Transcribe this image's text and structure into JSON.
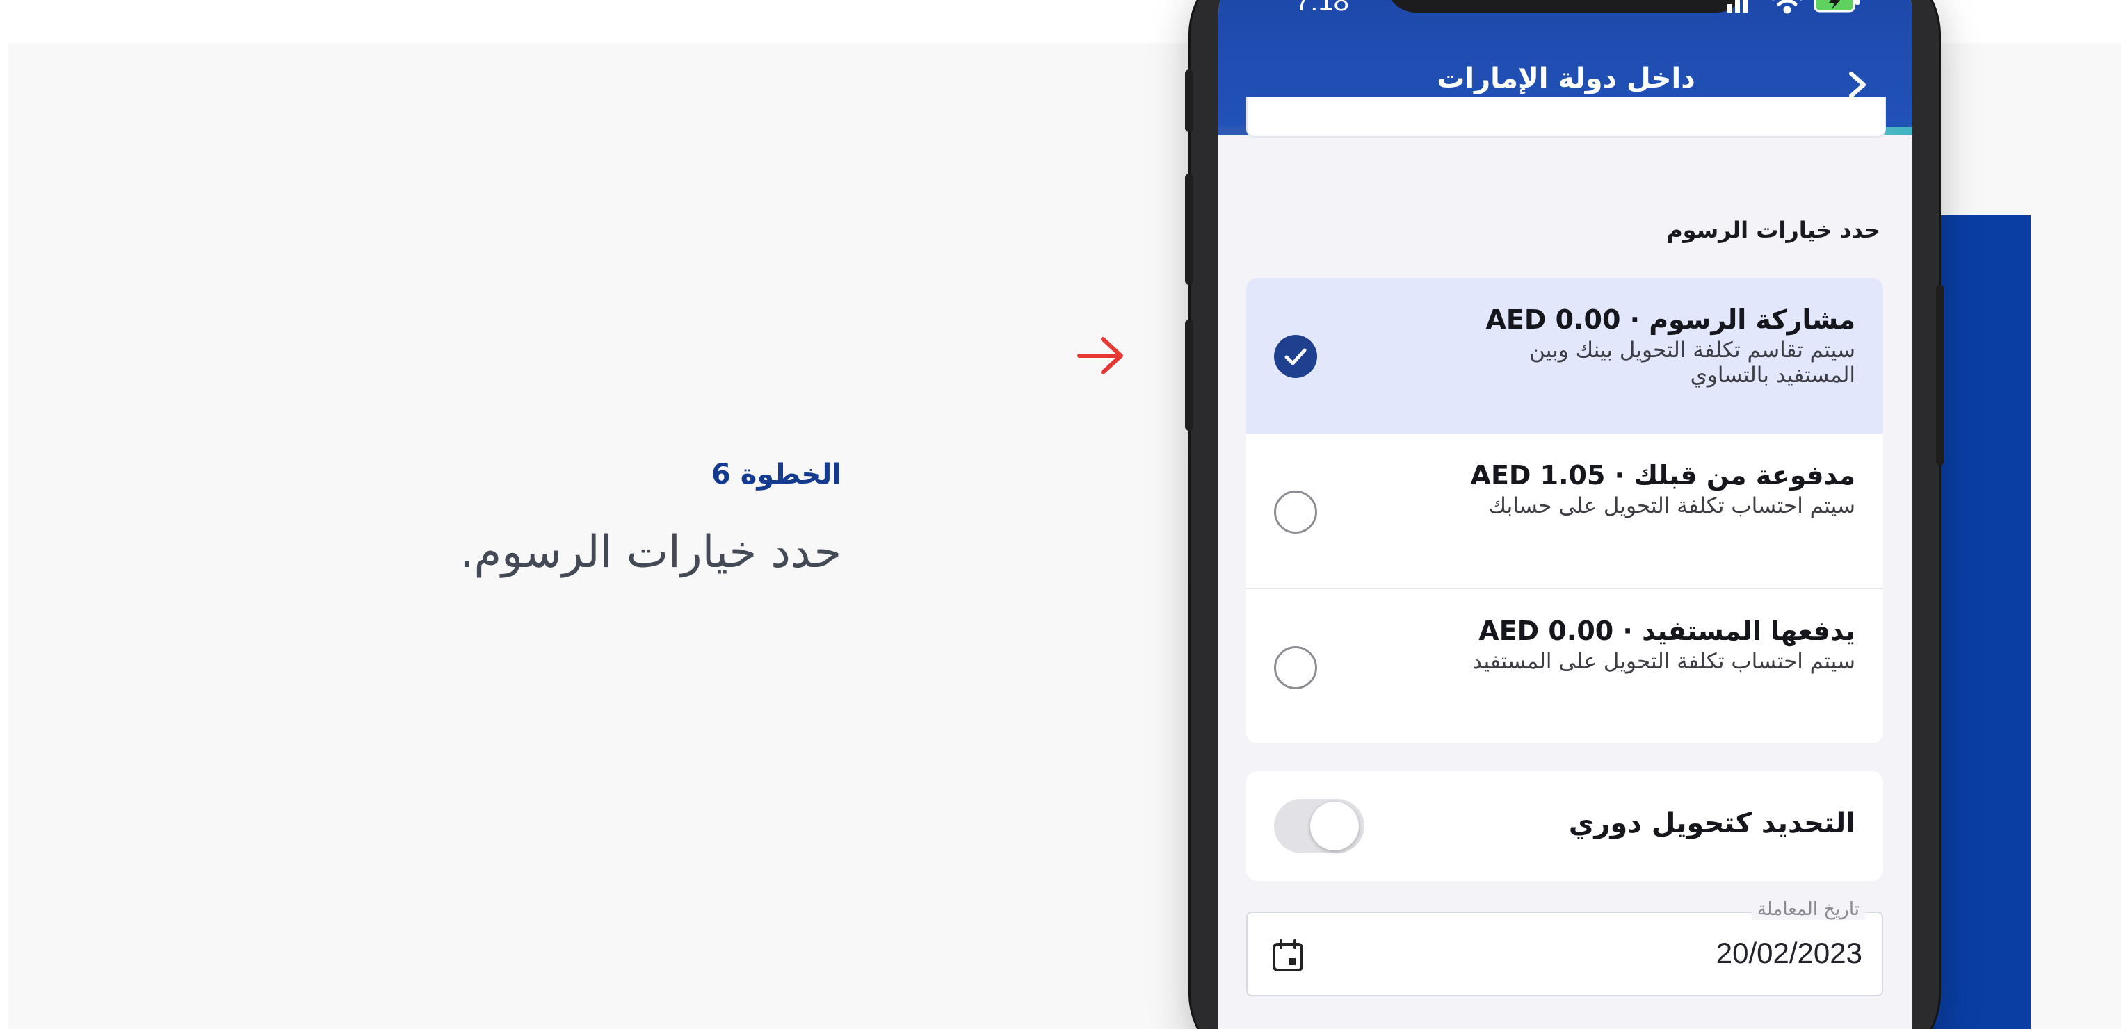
{
  "colors": {
    "brand_blue": "#0a3ea3",
    "appbar_blue": "#1d46a7",
    "accent_teal": "#3fb3c0",
    "step_label": "#153b91",
    "arrow_red": "#e53935",
    "selected_bg": "#e3e7fb"
  },
  "instruction": {
    "step": "الخطوة 6",
    "text": "حدد خيارات الرسوم."
  },
  "phone": {
    "status_bar": {
      "time": "7:18",
      "icons": [
        "signal-icon",
        "wifi-icon",
        "battery-charging-icon"
      ]
    },
    "appbar": {
      "title": "داخل دولة الإمارات",
      "back_icon": "chevron-right-icon",
      "progress_fraction": 0.17
    },
    "fees_section": {
      "label": "حدد خيارات الرسوم",
      "options": [
        {
          "title": "مشاركة الرسوم · AED 0.00",
          "description": "سيتم تقاسم تكلفة التحويل بينك وبين المستفيد بالتساوي",
          "selected": true
        },
        {
          "title": "مدفوعة من قبلك · AED 1.05",
          "description": "سيتم احتساب تكلفة التحويل على حسابك",
          "selected": false
        },
        {
          "title": "يدفعها المستفيد · AED 0.00",
          "description": "سيتم احتساب تكلفة التحويل على المستفيد",
          "selected": false
        }
      ]
    },
    "recurring": {
      "label": "التحديد كتحويل دوري",
      "enabled": false
    },
    "transaction_date": {
      "label": "تاريخ المعاملة",
      "value": "20/02/2023",
      "icon": "calendar-icon"
    }
  }
}
